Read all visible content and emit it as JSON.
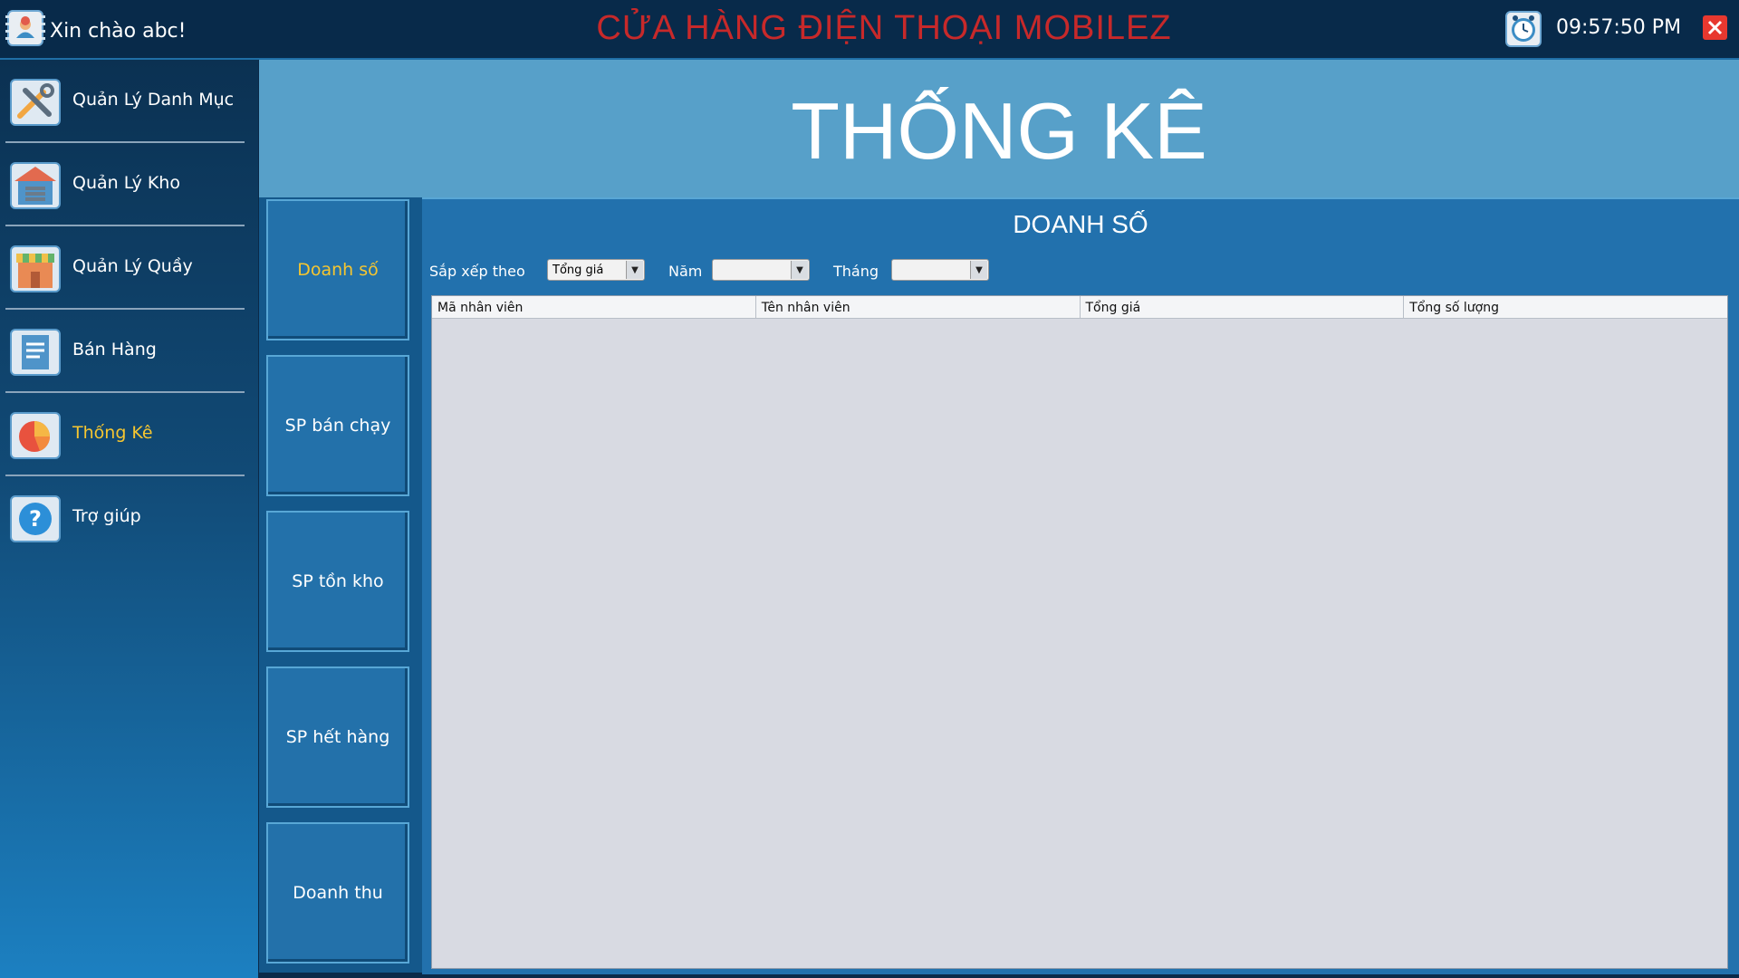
{
  "topbar": {
    "greeting": "Xin chào abc!",
    "store_title": "CỬA HÀNG ĐIỆN THOẠI MOBILEZ",
    "clock": "09:57:50 PM",
    "title_color": "#c7292a",
    "greet_icon": "user-avatar-icon",
    "clock_icon": "alarm-clock-icon",
    "close_icon": "close-icon"
  },
  "sidebar": {
    "items": [
      {
        "label": "Quản Lý Danh Mục",
        "icon": "tools-icon"
      },
      {
        "label": "Quản Lý Kho",
        "icon": "warehouse-icon"
      },
      {
        "label": "Quản Lý Quầy",
        "icon": "store-counter-icon"
      },
      {
        "label": "Bán Hàng",
        "icon": "sales-receipt-icon"
      },
      {
        "label": "Thống Kê",
        "icon": "pie-chart-icon",
        "active": true
      },
      {
        "label": "Trợ giúp",
        "icon": "help-icon"
      }
    ],
    "active_color": "#f6c630"
  },
  "header": {
    "title": "THỐNG KÊ"
  },
  "subnav": {
    "buttons": [
      {
        "label": "Doanh số",
        "active": true
      },
      {
        "label": "SP bán chạy"
      },
      {
        "label": "SP tồn kho"
      },
      {
        "label": "SP hết hàng"
      },
      {
        "label": "Doanh thu"
      }
    ]
  },
  "main": {
    "title": "DOANH SỐ",
    "filters": {
      "sort_label": "Sắp xếp theo",
      "sort_value": "Tổng giá",
      "year_label": "Năm",
      "year_value": "",
      "month_label": "Tháng",
      "month_value": ""
    },
    "table": {
      "columns": [
        "Mã nhân viên",
        "Tên nhân viên",
        "Tổng giá",
        "Tổng số lượng"
      ],
      "rows": []
    }
  }
}
